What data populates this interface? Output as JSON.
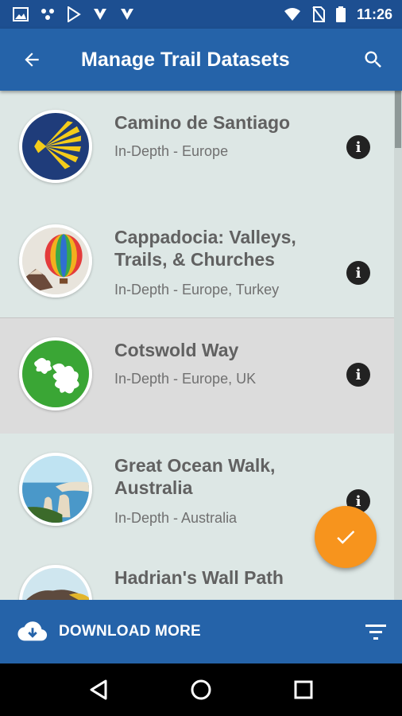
{
  "status_bar": {
    "time": "11:26"
  },
  "app_bar": {
    "title": "Manage Trail Datasets"
  },
  "trails": [
    {
      "name": "Camino de Santiago",
      "subtitle": "In-Depth - Europe",
      "icon": "scallop-shell-icon"
    },
    {
      "name": "Cappadocia: Valleys, Trails, & Churches",
      "subtitle": "In-Depth - Europe, Turkey",
      "icon": "hot-air-balloon-icon"
    },
    {
      "name": "Cotswold Way",
      "subtitle": "In-Depth - Europe, UK",
      "icon": "oak-leaf-icon"
    },
    {
      "name": "Great Ocean Walk, Australia",
      "subtitle": "In-Depth - Australia",
      "icon": "coastal-rocks-icon"
    },
    {
      "name": "Hadrian's Wall Path",
      "subtitle": "",
      "icon": "hills-icon"
    }
  ],
  "info_glyph": "i",
  "bottom_bar": {
    "download_label": "DOWNLOAD MORE"
  },
  "colors": {
    "primary": "#2563a9",
    "status": "#1d4f91",
    "accent": "#f7941d",
    "list_bg": "#dde7e5",
    "selected_bg": "#dcdcdc"
  }
}
